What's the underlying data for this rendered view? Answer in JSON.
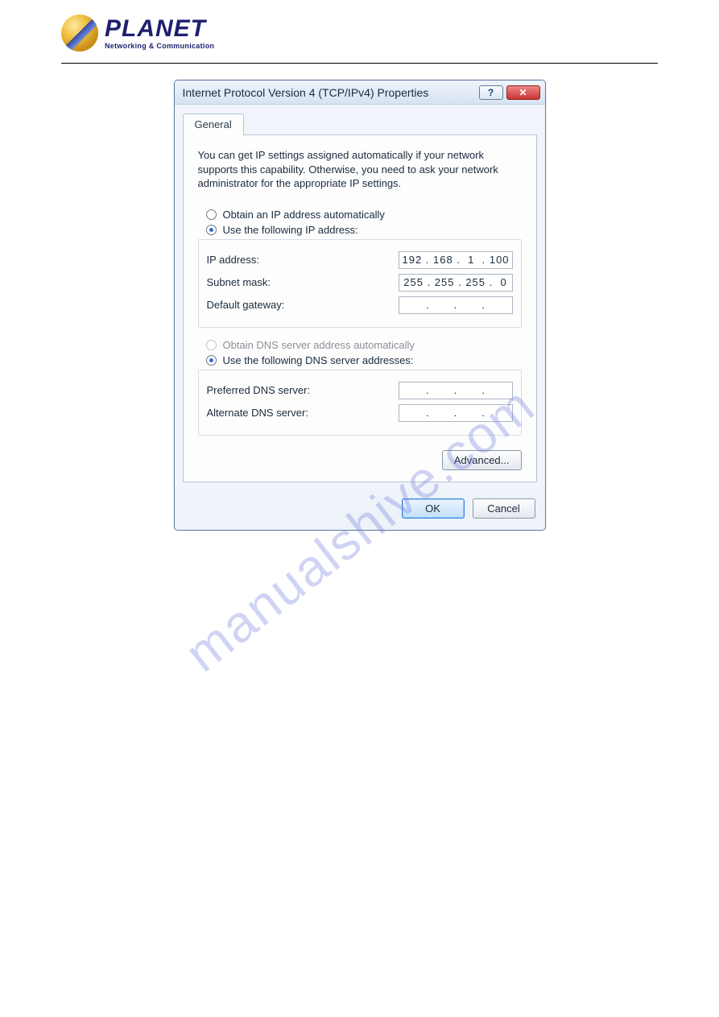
{
  "header": {
    "logo_name": "PLANET",
    "logo_tagline": "Networking & Communication"
  },
  "watermark": "manualshive.com",
  "dialog": {
    "title": "Internet Protocol Version 4 (TCP/IPv4) Properties",
    "help_symbol": "?",
    "close_symbol": "✕",
    "tab_label": "General",
    "description": "You can get IP settings assigned automatically if your network supports this capability. Otherwise, you need to ask your network administrator for the appropriate IP settings.",
    "ip_section": {
      "radio_auto": "Obtain an IP address automatically",
      "radio_manual": "Use the following IP address:",
      "ip_label": "IP address:",
      "ip_value": "192 . 168 .  1  . 100",
      "subnet_label": "Subnet mask:",
      "subnet_value": "255 . 255 . 255 .  0",
      "gateway_label": "Default gateway:"
    },
    "dns_section": {
      "radio_auto": "Obtain DNS server address automatically",
      "radio_manual": "Use the following DNS server addresses:",
      "preferred_label": "Preferred DNS server:",
      "alternate_label": "Alternate DNS server:"
    },
    "advanced_button": "Advanced...",
    "ok_button": "OK",
    "cancel_button": "Cancel"
  }
}
